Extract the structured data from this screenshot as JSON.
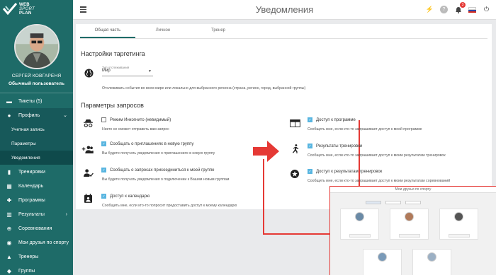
{
  "app": {
    "logo_line1": "WEB",
    "logo_line2": "SPORT",
    "logo_line3": "PLAN"
  },
  "header": {
    "title": "Уведомления",
    "notification_count": "3"
  },
  "profile": {
    "name": "СЕРГЕЙ КОВГАРЕНЯ",
    "role": "Обычный пользователь"
  },
  "sidebar": {
    "items": [
      {
        "label": "Тикеты (5)",
        "icon": "ticket-icon"
      },
      {
        "label": "Профиль",
        "icon": "person-icon"
      },
      {
        "label": "Учетная запись"
      },
      {
        "label": "Параметры"
      },
      {
        "label": "Уведомления"
      },
      {
        "label": "Тренировки",
        "icon": "dumbbell-icon"
      },
      {
        "label": "Календарь",
        "icon": "calendar-icon"
      },
      {
        "label": "Программы",
        "icon": "puzzle-icon"
      },
      {
        "label": "Результаты",
        "icon": "bar-chart-icon"
      },
      {
        "label": "Соревнования",
        "icon": "plus-circle-icon"
      },
      {
        "label": "Мои друзья по спорту",
        "icon": "chat-icon"
      },
      {
        "label": "Тренеры",
        "icon": "graduation-cap-icon"
      },
      {
        "label": "Группы",
        "icon": "group-icon"
      }
    ]
  },
  "tabs": [
    {
      "label": "Общая часть",
      "active": true
    },
    {
      "label": "Личное",
      "active": false
    },
    {
      "label": "Тренер",
      "active": false
    }
  ],
  "targeting": {
    "section_title": "Настройки таргетинга",
    "field_label": "Тип отслеживания",
    "field_value": "Мир",
    "description": "Отслеживать события во всем мире или локально для выбранного региона (страна, регион, город, выбранной группы)"
  },
  "requests": {
    "section_title": "Параметры запросов",
    "options": [
      {
        "label": "Режим Инкогнито (невидимый)",
        "checked": false,
        "desc": "Никто не сможет отправить вам запрос"
      },
      {
        "label": "Сообщать о приглашениях в новую группу",
        "checked": true,
        "desc": "Вы будете получать уведомления о приглашениях в новую группу"
      },
      {
        "label": "Сообщать о запросах присоединиться к моей группе",
        "checked": true,
        "desc": "Вы будете получать уведомления о подключении к Вашим новым группам"
      },
      {
        "label": "Доступ к календарю",
        "checked": true,
        "desc": "Сообщить мне, если кто-то попросит предоставить доступ к моему календарю"
      },
      {
        "label": "Доступ к программе",
        "checked": true,
        "desc": "Сообщить мне, если кто-то запрашивает доступ к моей программе"
      },
      {
        "label": "Результаты тренировки",
        "checked": true,
        "desc": "Сообщить мне, если кто-то запрашивает доступ к моим результатам тренировок"
      },
      {
        "label": "Доступ к результатам тренировок",
        "checked": true,
        "desc": "Сообщить мне, если кто-то запрашивает доступ к моим результатам соревнований"
      }
    ]
  },
  "inset": {
    "title": "Мои друзья по спорту"
  },
  "colors": {
    "sidebar": "#1e6b68",
    "accent": "#58b5e0",
    "annotation": "#e53935"
  }
}
